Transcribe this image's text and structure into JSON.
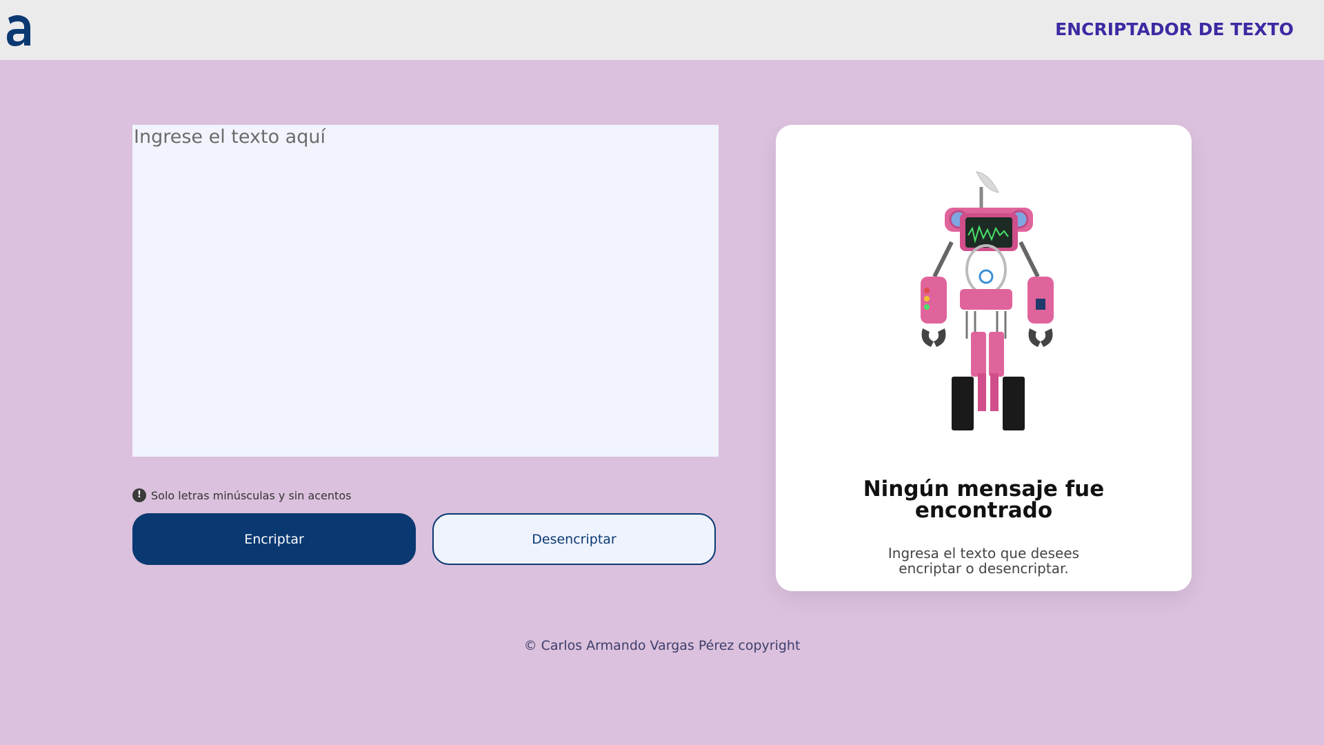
{
  "header": {
    "logo_icon": "alura-a-logo",
    "title": "ENCRIPTADOR DE TEXTO"
  },
  "main": {
    "input_placeholder": "Ingrese el texto aquí",
    "input_value": "",
    "hint_icon": "exclamation-circle-icon",
    "hint_text": "Solo letras minúsculas y sin acentos",
    "encrypt_label": "Encriptar",
    "decrypt_label": "Desencriptar"
  },
  "output": {
    "illustration": "robot-illustration",
    "title": "Ningún mensaje fue encontrado",
    "text": "Ingresa el texto que desees encriptar o desencriptar."
  },
  "footer": {
    "text": "© Carlos Armando Vargas Pérez copyright"
  },
  "colors": {
    "background": "#dbc1dd",
    "header_bg": "#ebebeb",
    "title": "#3b2aa3",
    "primary": "#0a3871",
    "input_bg": "#f1f4fd",
    "robot_pink": "#e0649c"
  }
}
